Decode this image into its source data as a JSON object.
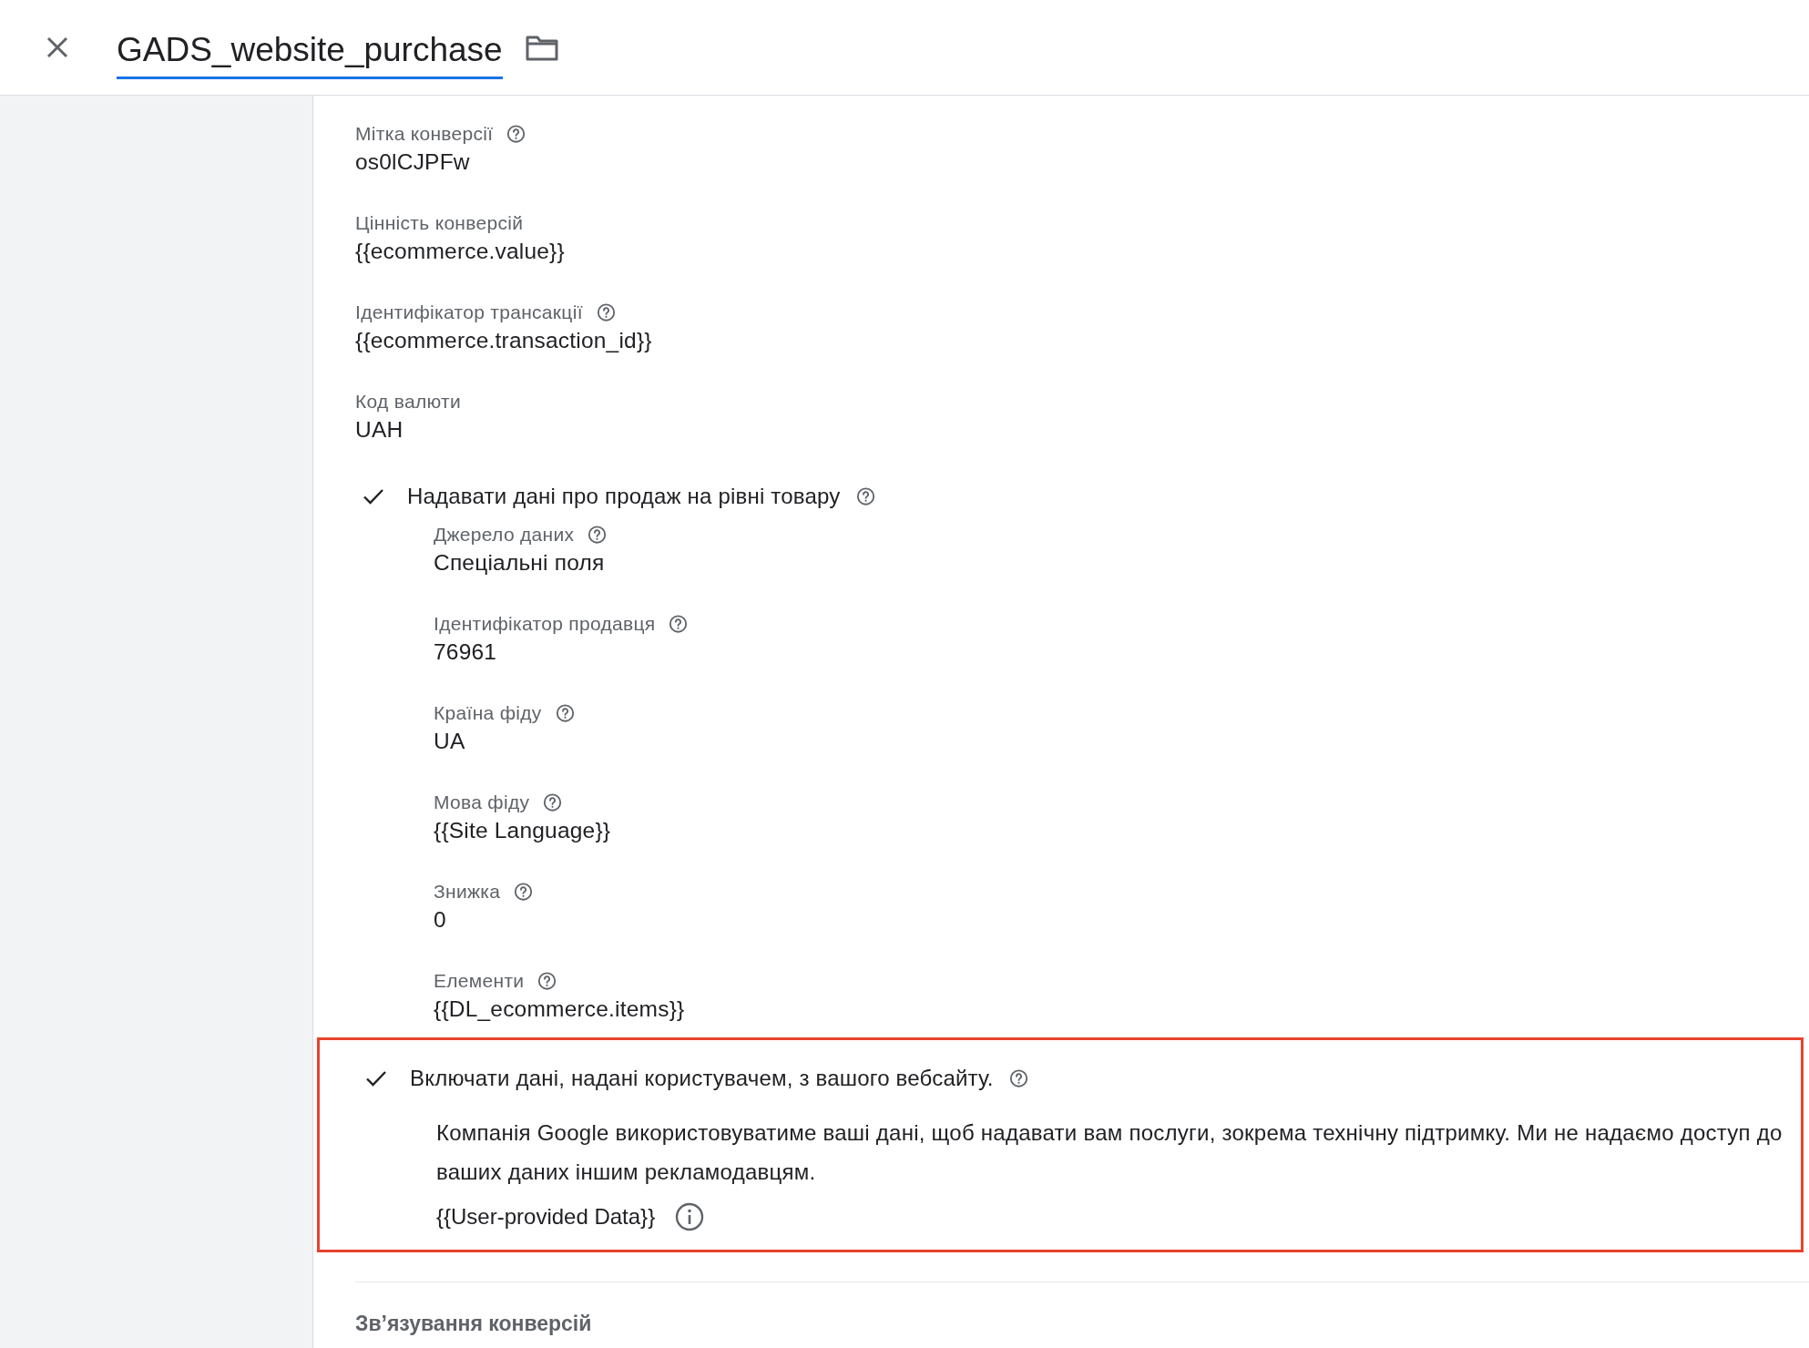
{
  "header": {
    "title": "GADS_website_purchase"
  },
  "fields": [
    {
      "label": "Мітка конверсії",
      "value": "os0lCJPFw",
      "help": true
    },
    {
      "label": "Цінність конверсій",
      "value": "{{ecommerce.value}}",
      "help": false
    },
    {
      "label": "Ідентифікатор трансакції",
      "value": "{{ecommerce.transaction_id}}",
      "help": true
    },
    {
      "label": "Код валюти",
      "value": "UAH",
      "help": false
    }
  ],
  "product_data": {
    "checked": true,
    "label": "Надавати дані про продаж на рівні товару",
    "help": true,
    "fields": [
      {
        "label": "Джерело даних",
        "value": "Спеціальні поля",
        "help": true
      },
      {
        "label": "Ідентифікатор продавця",
        "value": "76961",
        "help": true
      },
      {
        "label": "Країна фіду",
        "value": "UA",
        "help": true
      },
      {
        "label": "Мова фіду",
        "value": "{{Site Language}}",
        "help": true
      },
      {
        "label": "Знижка",
        "value": "0",
        "help": true
      },
      {
        "label": "Елементи",
        "value": "{{DL_ecommerce.items}}",
        "help": true
      }
    ]
  },
  "user_data": {
    "checked": true,
    "highlighted": true,
    "label": "Включати дані, надані користувачем, з вашого вебсайту.",
    "help": true,
    "description": "Компанія Google використовуватиме ваші дані, щоб надавати вам послуги, зокрема технічну підтримку. Ми не надаємо доступ до ваших даних іншим рекламодавцям.",
    "value": "{{User-provided Data}}"
  },
  "section": {
    "title": "Зв’язування конверсій"
  }
}
